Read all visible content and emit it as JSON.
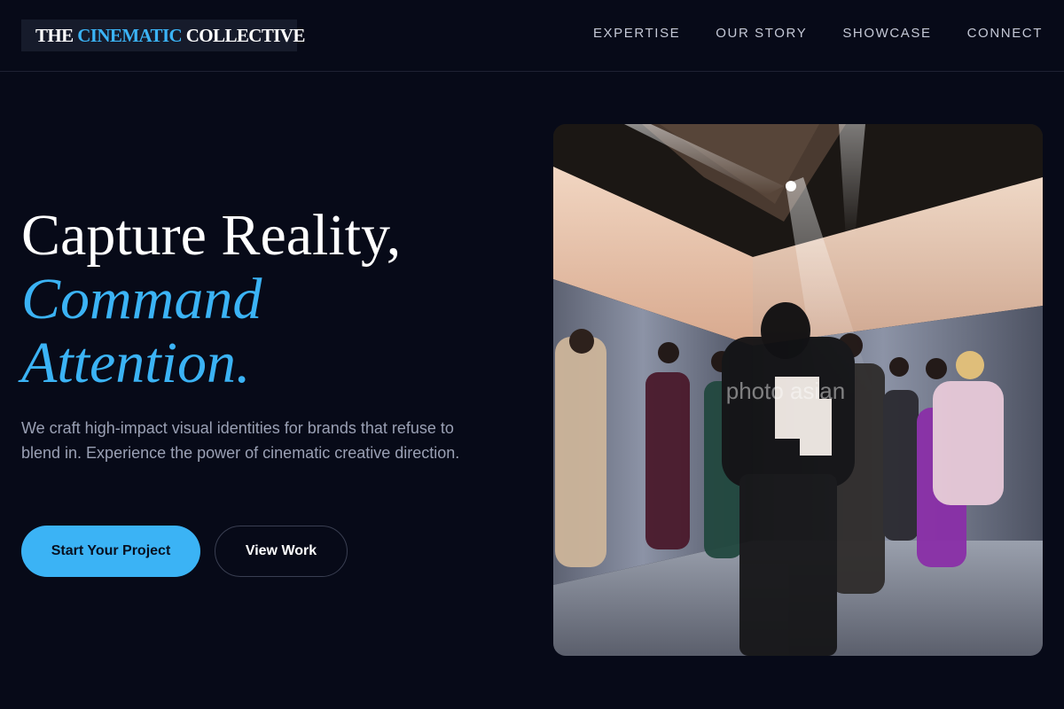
{
  "header": {
    "logo": {
      "part1": "THE ",
      "accent": "CINEMATIC",
      "part2": " COLLECTIVE"
    },
    "nav": [
      "EXPERTISE",
      "OUR STORY",
      "SHOWCASE",
      "CONNECT"
    ]
  },
  "hero": {
    "headline_line1": "Capture Reality,",
    "headline_line2": "Command",
    "headline_line3": "Attention.",
    "subtitle": "We craft high-impact visual identities for brands that refuse to blend in. Experience the power of cinematic creative direction.",
    "primary_button": "Start Your Project",
    "secondary_button": "View Work"
  },
  "image": {
    "watermark": "photo asian"
  },
  "colors": {
    "background": "#070a18",
    "accent": "#3bb3f5",
    "muted_text": "#9aa0b4"
  }
}
